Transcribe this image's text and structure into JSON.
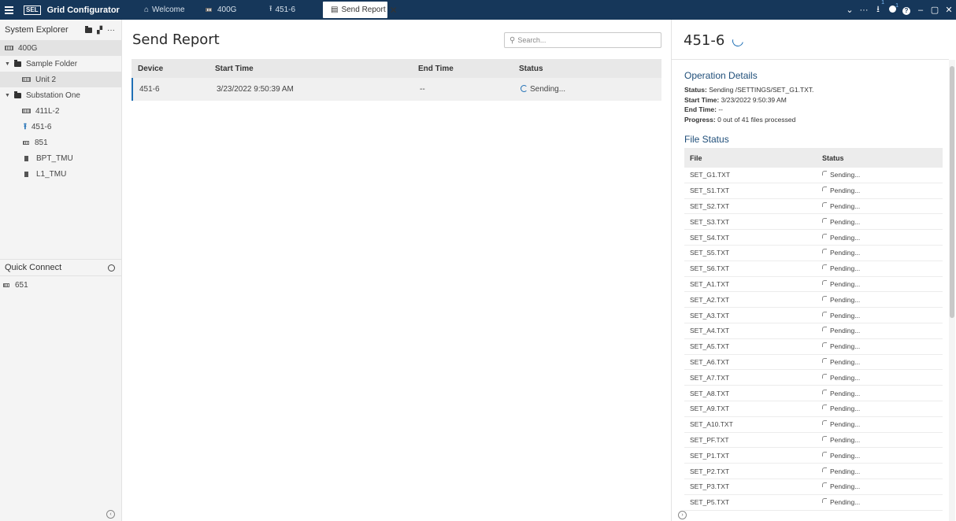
{
  "app": {
    "title": "Grid Configurator",
    "logo": "SEL"
  },
  "tabs": [
    {
      "label": "Welcome",
      "icon": "home-icon"
    },
    {
      "label": "400G",
      "icon": "device-icon"
    },
    {
      "label": "451-6",
      "icon": "upload-icon"
    },
    {
      "label": "Send Report",
      "icon": "report-icon",
      "active": true
    }
  ],
  "window_controls": {
    "notif_badge_1": "1",
    "notif_badge_2": "1"
  },
  "sidebar": {
    "title": "System Explorer",
    "tree": [
      {
        "label": "400G",
        "icon": "device-icon",
        "level": 0,
        "selected": true
      },
      {
        "label": "Sample Folder",
        "icon": "folder-icon",
        "level": 0,
        "expanded": true
      },
      {
        "label": "Unit 2",
        "icon": "device-icon",
        "level": 1
      },
      {
        "label": "Substation One",
        "icon": "folder-icon",
        "level": 0,
        "expanded": true
      },
      {
        "label": "411L-2",
        "icon": "device-icon",
        "level": 1
      },
      {
        "label": "451-6",
        "icon": "upload-icon",
        "level": 1
      },
      {
        "label": "851",
        "icon": "device-icon",
        "level": 1
      },
      {
        "label": "BPT_TMU",
        "icon": "tmu-icon",
        "level": 1
      },
      {
        "label": "L1_TMU",
        "icon": "tmu-icon",
        "level": 1
      }
    ],
    "quick_connect": {
      "title": "Quick Connect",
      "items": [
        {
          "label": "651"
        }
      ]
    }
  },
  "main": {
    "title": "Send Report",
    "search_placeholder": "Search...",
    "columns": [
      "Device",
      "Start Time",
      "End Time",
      "Status"
    ],
    "rows": [
      {
        "device": "451-6",
        "start": "3/23/2022 9:50:39 AM",
        "end": "--",
        "status": "Sending..."
      }
    ]
  },
  "details": {
    "title": "451-6",
    "op_section": "Operation Details",
    "status_label": "Status:",
    "status_value": "Sending /SETTINGS/SET_G1.TXT.",
    "start_label": "Start Time:",
    "start_value": "3/23/2022 9:50:39 AM",
    "end_label": "End Time:",
    "end_value": "--",
    "progress_label": "Progress:",
    "progress_value": "0 out of 41 files processed",
    "file_section": "File Status",
    "file_columns": [
      "File",
      "Status"
    ],
    "files": [
      {
        "file": "SET_G1.TXT",
        "status": "Sending..."
      },
      {
        "file": "SET_S1.TXT",
        "status": "Pending..."
      },
      {
        "file": "SET_S2.TXT",
        "status": "Pending..."
      },
      {
        "file": "SET_S3.TXT",
        "status": "Pending..."
      },
      {
        "file": "SET_S4.TXT",
        "status": "Pending..."
      },
      {
        "file": "SET_S5.TXT",
        "status": "Pending..."
      },
      {
        "file": "SET_S6.TXT",
        "status": "Pending..."
      },
      {
        "file": "SET_A1.TXT",
        "status": "Pending..."
      },
      {
        "file": "SET_A2.TXT",
        "status": "Pending..."
      },
      {
        "file": "SET_A3.TXT",
        "status": "Pending..."
      },
      {
        "file": "SET_A4.TXT",
        "status": "Pending..."
      },
      {
        "file": "SET_A5.TXT",
        "status": "Pending..."
      },
      {
        "file": "SET_A6.TXT",
        "status": "Pending..."
      },
      {
        "file": "SET_A7.TXT",
        "status": "Pending..."
      },
      {
        "file": "SET_A8.TXT",
        "status": "Pending..."
      },
      {
        "file": "SET_A9.TXT",
        "status": "Pending..."
      },
      {
        "file": "SET_A10.TXT",
        "status": "Pending..."
      },
      {
        "file": "SET_PF.TXT",
        "status": "Pending..."
      },
      {
        "file": "SET_P1.TXT",
        "status": "Pending..."
      },
      {
        "file": "SET_P2.TXT",
        "status": "Pending..."
      },
      {
        "file": "SET_P3.TXT",
        "status": "Pending..."
      },
      {
        "file": "SET_P5.TXT",
        "status": "Pending..."
      }
    ]
  },
  "colors": {
    "titlebar": "#16375a",
    "accent": "#1f6fb5",
    "section_heading": "#1f4e79"
  }
}
